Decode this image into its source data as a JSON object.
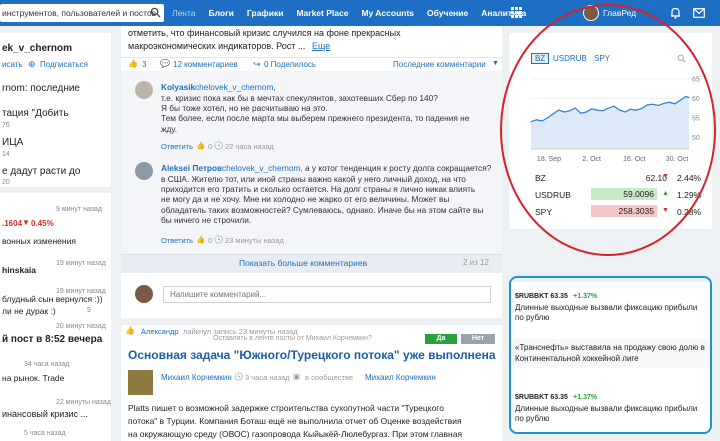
{
  "topbar": {
    "search_text": "инструментов, пользователей и постов",
    "nav": [
      "Лента",
      "Блоги",
      "Графики",
      "Market Place",
      "My Accounts",
      "Обучение",
      "Аналитика"
    ],
    "user_name": "ГлавРед"
  },
  "left": {
    "user": "ek_v_chernom",
    "action1": "исать",
    "action2": "Подписаться",
    "heading": "rnom: последние",
    "item1": "тация \"Добить",
    "item1_count": "76",
    "item2": "ИЦА",
    "item2_count": "14",
    "item3": "е дадут расти до",
    "item3_count": "20",
    "time1": "9 минут назад",
    "quote_a": ".1604",
    "quote_b": "0.45%",
    "change_text": "вонных изменения",
    "time2": "19 минут назад",
    "user2": "hinskaia",
    "time3": "19 минут назад",
    "line1": "блудный сын вернулся :))",
    "line2": "ли не дурак :)",
    "line2_count": "9",
    "time4": "20 минут назад",
    "post_title": "й пост в 8:52 вечера",
    "post_time": "34 часа назад",
    "post_text": "на рынок. Trade",
    "time5": "22 минуты назад",
    "finance": "инансовый кризис ...",
    "finance_time": "5 часа назад"
  },
  "post": {
    "text1": "отметить, что финансовый кризис случился на фоне прекрасных",
    "text2": "макроэкономических индикаторов. Рост ...",
    "more": "Еще",
    "likes": "3",
    "comments_count": "12 комментариев",
    "share": "0 Поделилось",
    "latest": "Последние комментарии"
  },
  "comments": [
    {
      "author": "Kolyasik",
      "reply_to": "chelovek_v_chernom,",
      "text": "т.е. кризис пока как бы в мечтах спекулянтов, захотевших Сбер по 140?\nЯ бы тоже хотел, но не расчитываю на это.\nТем более, если после марта мы выберем прежнего президента, то падения не\nжду.",
      "reply": "Ответить",
      "count": "0",
      "time": "22 часа назад"
    },
    {
      "author": "Aleksei Петров",
      "reply_to": "chelovek_v_chernom,",
      "text_tail": "а у котог тенденция к росту долга сокращается?",
      "text": "в США. Жителю тот, или иной страны важно какой у него личный доход, на что\nприходится его тратить и сколько остается. На долг страны я лично никак влиять\nне могу да и не хочу. Мне ни холодно не жарко от его величины. Может вы\nобладатель таких возможностей? Сумлеваюсь, однако. Иначе бы на этом сайте вы\nбы ничего не строчили.",
      "reply": "Ответить",
      "count": "0",
      "time": "23 минуты назад"
    }
  ],
  "more_comments": {
    "label": "Показать больше комментариев",
    "counter": "2 из 12"
  },
  "comment_input": {
    "placeholder": "Напишите комментарий..."
  },
  "feed": {
    "liked_user": "Александр",
    "liked_text": "лайкнул запись 23 минуты назад",
    "question": "Оставлять в ленте посты от Михаил Корчемкин?",
    "yes": "Да",
    "no": "Нет",
    "title": "Основная задача \"Южного/Турецкого потока\" уже выполнена",
    "author": "Михаил Корчемкин",
    "time": "3 часа назад",
    "community_prefix": "в сообществе",
    "community": "Михаил Корчемкин",
    "body1": "Platts пишет о возможной задержке строительства сухопутной части \"Турецкого",
    "body2": "потока\" в Турции. Компания Боташ ещё не выполнила отчет об Оценке воздействия",
    "body3": "на окружающую среду (ОВОС) газопровода Кыйыкёй-Люлебургаз. При этом главная"
  },
  "widget": {
    "tabs": [
      "BZ",
      "USDRUB",
      "SPY"
    ],
    "quotes": [
      {
        "name": "BZ",
        "price": "62.10",
        "arrow": "▼",
        "change": "2.44%",
        "dir": "down"
      },
      {
        "name": "USDRUB",
        "price": "59.0096",
        "arrow": "▲",
        "change": "1.29%",
        "dir": "up"
      },
      {
        "name": "SPY",
        "price": "258.3035",
        "arrow": "▼",
        "change": "0.28%",
        "dir": "down"
      }
    ],
    "chart_colors": {
      "line": "#2d7fd2",
      "fill": "#dceaf8",
      "up": "#2aa23b",
      "down": "#d0302b"
    }
  },
  "chart_data": {
    "type": "area",
    "x_ticks": [
      "18. Sep",
      "2. Oct",
      "16. Oct",
      "30. Oct"
    ],
    "y_ticks": [
      65,
      60,
      55,
      50
    ],
    "ylim": [
      47,
      66
    ],
    "x": [
      0,
      0.035,
      0.07,
      0.105,
      0.14,
      0.175,
      0.21,
      0.245,
      0.28,
      0.315,
      0.35,
      0.385,
      0.42,
      0.455,
      0.49,
      0.525,
      0.56,
      0.595,
      0.63,
      0.665,
      0.7,
      0.735,
      0.77,
      0.805,
      0.84,
      0.875,
      0.91,
      0.945,
      0.98,
      1
    ],
    "values": [
      54,
      54.5,
      54.2,
      55,
      56,
      57,
      56.5,
      56.8,
      57.5,
      56.2,
      56.5,
      57.3,
      57,
      56.8,
      57.5,
      58,
      57,
      56.5,
      57.2,
      57,
      57.4,
      58.3,
      58.5,
      58.2,
      58.7,
      59,
      58.6,
      59.5,
      60.5,
      60.2
    ]
  },
  "news": [
    {
      "ticker": "$RUBBKT 63.35",
      "change": "+1.37%",
      "text": "Длинные выходные вызвали фиксацию прибыли по рублю"
    },
    {
      "ticker": "",
      "change": "",
      "text": "«Транснефть» выставила на продажу свою долю в Континентальной хоккейной лиге"
    },
    {
      "ticker": "$RUBBKT 63.35",
      "change": "+1.37%",
      "text": "Длинные выходные вызвали фиксацию прибыли по рублю"
    }
  ]
}
